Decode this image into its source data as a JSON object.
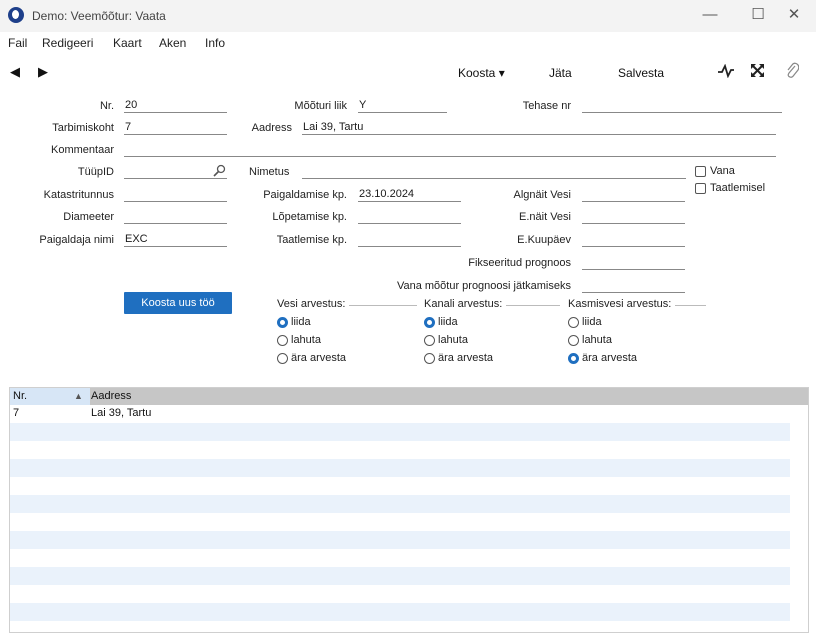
{
  "window": {
    "title": "Demo: Veemõõtur: Vaata",
    "minimize": "—",
    "maximize": "☐",
    "close": "✕"
  },
  "menu": [
    "Fail",
    "Redigeeri",
    "Kaart",
    "Aken",
    "Info"
  ],
  "toolbar": {
    "prev": "◀",
    "next": "▶",
    "create": "Koosta ▾",
    "discard": "Jäta",
    "save": "Salvesta",
    "icons": [
      "activity-icon",
      "expand-icon",
      "paperclip-icon"
    ]
  },
  "form": {
    "nr_label": "Nr.",
    "nr": "20",
    "meter_type_label": "Mõõturi liik",
    "meter_type": "Y",
    "factory_nr_label": "Tehase nr",
    "factory_nr": "",
    "consumption_label": "Tarbimiskoht",
    "consumption": "7",
    "address_label": "Aadress",
    "address": "Lai 39, Tartu",
    "comment_label": "Kommentaar",
    "comment": "",
    "typeid_label": "TüüpID",
    "typeid": "",
    "name_label": "Nimetus",
    "name": "",
    "old_label": "Vana",
    "testing_label": "Taatlemisel",
    "cadastre_label": "Katastritunnus",
    "cadastre": "",
    "install_date_label": "Paigaldamise kp.",
    "install_date": "23.10.2024",
    "initial_water_label": "Algnäit Vesi",
    "initial_water": "",
    "diameter_label": "Diameeter",
    "diameter": "",
    "end_date_label": "Lõpetamise kp.",
    "end_date": "",
    "end_water_label": "E.näit Vesi",
    "end_water": "",
    "installer_label": "Paigaldaja nimi",
    "installer": "EXC",
    "test_date_label": "Taatlemise kp.",
    "test_date": "",
    "e_date_label": "E.Kuupäev",
    "e_date": "",
    "fixed_forecast_label": "Fikseeritud prognoos",
    "fixed_forecast": "",
    "old_forecast_label": "Vana mõõtur prognoosi jätkamiseks",
    "old_forecast": "",
    "new_job_button": "Koosta uus töö"
  },
  "groups": [
    {
      "title": "Vesi arvestus:",
      "options": [
        "liida",
        "lahuta",
        "ära arvesta"
      ],
      "selected": 0
    },
    {
      "title": "Kanali arvestus:",
      "options": [
        "liida",
        "lahuta",
        "ära arvesta"
      ],
      "selected": 0
    },
    {
      "title": "Kasmisvesi arvestus:",
      "options": [
        "liida",
        "lahuta",
        "ära arvesta"
      ],
      "selected": 2
    }
  ],
  "table": {
    "columns": [
      "Nr.",
      "Aadress"
    ],
    "sort_indicator": "▲",
    "rows": [
      [
        "7",
        "Lai 39, Tartu"
      ]
    ]
  },
  "colors": {
    "accent": "#1f6fc0",
    "stripe": "#eaf2fb",
    "header": "#c6c6c6"
  }
}
